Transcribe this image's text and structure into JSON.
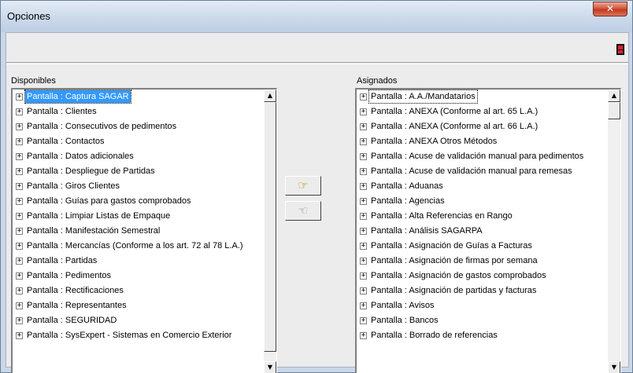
{
  "window": {
    "title": "Opciones",
    "close_glyph": "✕"
  },
  "toolbar": {
    "exit_icon": "exit-door-icon"
  },
  "available": {
    "label": "Disponibles",
    "items": [
      "Pantalla : Captura SAGAR",
      "Pantalla : Clientes",
      "Pantalla : Consecutivos de pedimentos",
      "Pantalla : Contactos",
      "Pantalla : Datos adicionales",
      "Pantalla : Despliegue de Partidas",
      "Pantalla : Giros Clientes",
      "Pantalla : Guías para gastos comprobados",
      "Pantalla : Limpiar Listas de Empaque",
      "Pantalla : Manifestación Semestral",
      "Pantalla : Mercancías  (Conforme a los art. 72 al 78 L.A.)",
      "Pantalla : Partidas",
      "Pantalla : Pedimentos",
      "Pantalla : Rectificaciones",
      "Pantalla : Representantes",
      "Pantalla : SEGURIDAD",
      "Pantalla : SysExpert - Sistemas en Comercio Exterior"
    ],
    "selected_index": 0
  },
  "assigned": {
    "label": "Asignados",
    "items": [
      "Pantalla : A.A./Mandatarios",
      "Pantalla : ANEXA (Conforme al art. 65 L.A.)",
      "Pantalla : ANEXA (Conforme al art. 66 L.A.)",
      "Pantalla : ANEXA Otros Métodos",
      "Pantalla : Acuse de validación manual para pedimentos",
      "Pantalla : Acuse de validación manual para remesas",
      "Pantalla : Aduanas",
      "Pantalla : Agencias",
      "Pantalla : Alta Referencias en Rango",
      "Pantalla : Análisis SAGARPA",
      "Pantalla : Asignación de Guías a Facturas",
      "Pantalla : Asignación de firmas por semana",
      "Pantalla : Asignación de gastos comprobados",
      "Pantalla : Asignación de partidas y facturas",
      "Pantalla : Avisos",
      "Pantalla : Bancos",
      "Pantalla : Borrado de referencias"
    ],
    "focused_index": 0
  },
  "buttons": {
    "assign_glyph": "☞",
    "unassign_glyph": "☜",
    "expand_glyph": "+",
    "scroll_up": "▲",
    "scroll_down": "▼",
    "scroll_left": "◀",
    "scroll_right": "▶"
  }
}
